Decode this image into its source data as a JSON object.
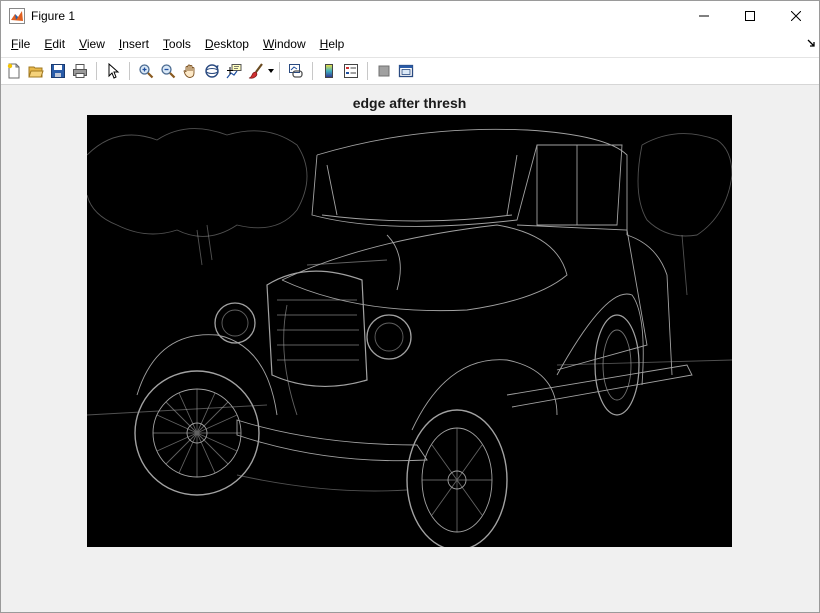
{
  "window": {
    "title": "Figure 1",
    "controls": [
      "minimize-icon",
      "maximize-icon",
      "close-icon"
    ]
  },
  "menubar": {
    "items": [
      {
        "accel": "F",
        "rest": "ile"
      },
      {
        "accel": "E",
        "rest": "dit"
      },
      {
        "accel": "V",
        "rest": "iew"
      },
      {
        "accel": "I",
        "rest": "nsert"
      },
      {
        "accel": "T",
        "rest": "ools"
      },
      {
        "accel": "D",
        "rest": "esktop"
      },
      {
        "accel": "W",
        "rest": "indow"
      },
      {
        "accel": "H",
        "rest": "elp"
      }
    ]
  },
  "toolbar": {
    "groups": [
      [
        "new-figure-icon",
        "open-file-icon",
        "save-icon",
        "print-icon"
      ],
      [
        "pointer-icon"
      ],
      [
        "zoom-in-icon",
        "zoom-out-icon",
        "pan-icon",
        "rotate-3d-icon",
        "data-cursor-icon",
        "brush-icon"
      ],
      [
        "link-plot-icon"
      ],
      [
        "colorbar-icon",
        "legend-icon"
      ],
      [
        "hide-plot-tools-icon",
        "show-plot-tools-icon"
      ]
    ]
  },
  "plot": {
    "title": "edge after thresh",
    "image_description": "edge-detected photo of a vintage car"
  },
  "colors": {
    "window_bg": "#f0f0f0",
    "image_bg": "#000000",
    "edge_color": "#d8d8d8"
  }
}
